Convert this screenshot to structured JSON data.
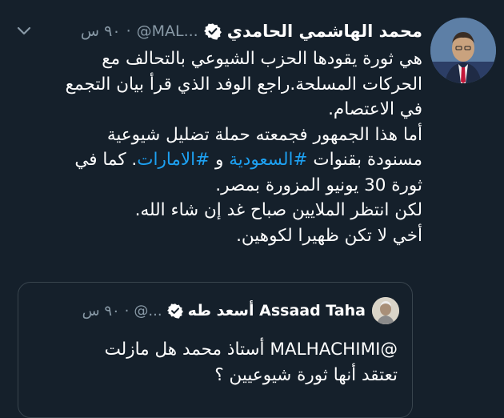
{
  "tweet": {
    "author_name": "محمد الهاشمي الحامدي",
    "handle": "@MAL...",
    "dot": "·",
    "time": "٩٠ س",
    "lines": [
      [
        "هي ثورة يقودها الحزب الشيوعي بالتحالف مع"
      ],
      [
        "الحركات المسلحة.راجع الوفد الذي قرأ بيان التجمع"
      ],
      [
        "في الاعتصام."
      ],
      [
        "أما هذا الجمهور فجمعته حملة تضليل شيوعية"
      ],
      [
        "مسنودة بقنوات ",
        "#السعودية",
        " و ",
        "#الامارات",
        ". كما في"
      ],
      [
        "ثورة 30 يونيو المزورة بمصر."
      ],
      [
        "لكن انتظر الملايين صباح غد إن شاء الله."
      ],
      [
        "أخي لا تكن ظهيرا لكوهين."
      ]
    ]
  },
  "quoted": {
    "author_name": "أسعد طه Assaad Taha",
    "handle": "@...",
    "dot": "·",
    "time": "٩٠ س",
    "line1": "@MALHACHIMI أستاذ محمد هل مازلت",
    "line2": "تعتقد أنها ثورة شيوعيين ؟"
  },
  "colors": {
    "background": "#15202b",
    "text": "#ffffff",
    "secondary": "#8899a6",
    "accent": "#1da1f2",
    "border": "#38444d"
  },
  "icons": [
    "verified-badge-icon",
    "chevron-down-icon",
    "author-avatar",
    "quoted-author-avatar"
  ]
}
